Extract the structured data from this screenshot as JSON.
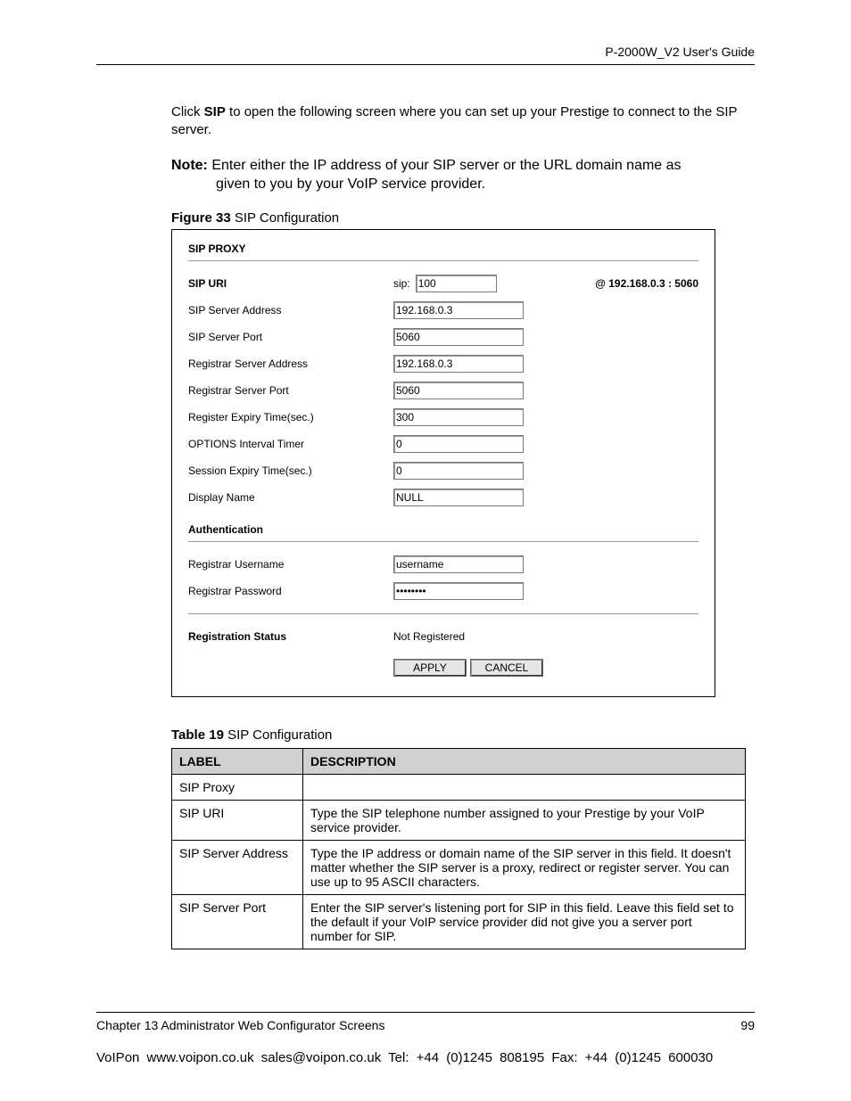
{
  "header": {
    "guide": "P-2000W_V2 User's Guide"
  },
  "intro": {
    "pre": "Click ",
    "bold": "SIP",
    "post": " to open the following screen where you can set up your Prestige to connect to the SIP server."
  },
  "note": {
    "label": "Note:",
    "line1": " Enter either the IP address of your SIP server or the URL domain name as",
    "line2": "given to you by your VoIP service provider."
  },
  "figure": {
    "label": "Figure 33",
    "title": "   SIP Configuration"
  },
  "form": {
    "sip_proxy": "SIP PROXY",
    "sip_uri": {
      "label": "SIP URI",
      "prefix": "sip:",
      "value": "100",
      "suffix": "@ 192.168.0.3 : 5060"
    },
    "server_addr": {
      "label": "SIP Server Address",
      "value": "192.168.0.3"
    },
    "server_port": {
      "label": "SIP Server Port",
      "value": "5060"
    },
    "reg_addr": {
      "label": "Registrar Server Address",
      "value": "192.168.0.3"
    },
    "reg_port": {
      "label": "Registrar Server Port",
      "value": "5060"
    },
    "reg_expiry": {
      "label": "Register Expiry Time(sec.)",
      "value": "300"
    },
    "options_timer": {
      "label": "OPTIONS Interval Timer",
      "value": "0"
    },
    "session_expiry": {
      "label": "Session Expiry Time(sec.)",
      "value": "0"
    },
    "display_name": {
      "label": "Display Name",
      "value": "NULL"
    },
    "auth": "Authentication",
    "reg_user": {
      "label": "Registrar Username",
      "value": "username"
    },
    "reg_pass": {
      "label": "Registrar Password",
      "value": "••••••••"
    },
    "reg_status": {
      "label": "Registration Status",
      "value": "Not Registered"
    },
    "apply": "APPLY",
    "cancel": "CANCEL"
  },
  "table": {
    "caption_label": "Table 19",
    "caption_title": "   SIP Configuration",
    "headers": {
      "label": "LABEL",
      "desc": "DESCRIPTION"
    },
    "rows": [
      {
        "label": "SIP Proxy",
        "desc": ""
      },
      {
        "label": "SIP URI",
        "desc": "Type the SIP telephone number assigned to your Prestige by your VoIP service provider."
      },
      {
        "label": "SIP Server Address",
        "desc": "Type the IP address or domain name of the SIP server in this field. It doesn't matter whether the SIP server is a proxy, redirect or register server. You can use up to 95 ASCII characters."
      },
      {
        "label": "SIP Server Port",
        "desc": "Enter the SIP server's listening port for SIP in this field. Leave this field set to the default if your VoIP service provider did not give you a server port number for SIP."
      }
    ]
  },
  "footer": {
    "chapter": "Chapter 13 Administrator Web Configurator Screens",
    "page": "99",
    "line2": "VoIPon    www.voipon.co.uk    sales@voipon.co.uk    Tel: +44 (0)1245 808195    Fax: +44 (0)1245 600030"
  }
}
